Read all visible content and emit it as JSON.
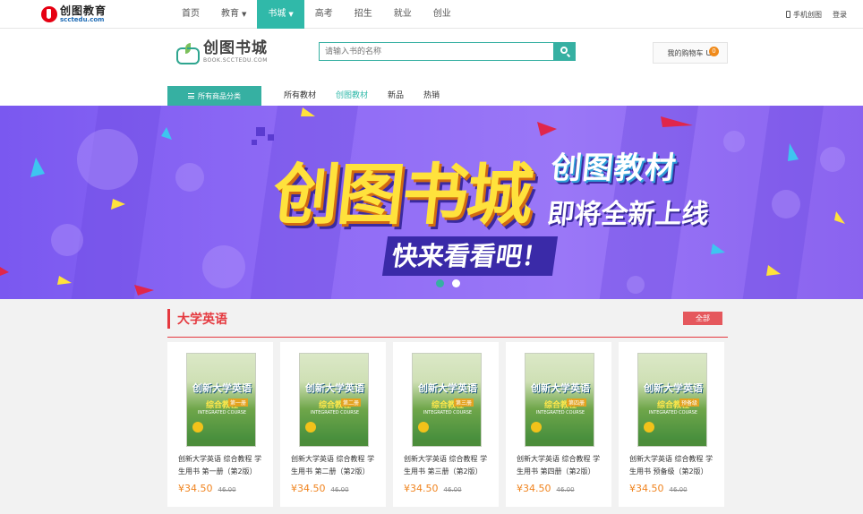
{
  "topbar": {
    "logo_cn": "创图教育",
    "logo_en": "scctedu.com",
    "nav": [
      {
        "label": "首页",
        "caret": false
      },
      {
        "label": "教育",
        "caret": true
      },
      {
        "label": "书城",
        "caret": true,
        "active": true
      },
      {
        "label": "高考",
        "caret": false
      },
      {
        "label": "招生",
        "caret": false
      },
      {
        "label": "就业",
        "caret": false
      },
      {
        "label": "创业",
        "caret": false
      }
    ],
    "mobile_label": "手机创图",
    "login_label": "登录"
  },
  "header": {
    "shop_cn": "创图书城",
    "shop_en": "BOOK.SCCTEDU.COM",
    "search_placeholder": "请输入书的名称",
    "cart_label": "我的购物车",
    "cart_count": "0",
    "category_label": "所有商品分类",
    "sub_nav": [
      {
        "label": "所有教材",
        "active": false
      },
      {
        "label": "创图教材",
        "active": true
      },
      {
        "label": "新品",
        "active": false
      },
      {
        "label": "热销",
        "active": false
      }
    ]
  },
  "banner": {
    "title": "创图书城",
    "line1": "创图教材",
    "line2": "即将全新上线",
    "line3": "快来看看吧！",
    "slides": 2,
    "active_slide": 0
  },
  "section": {
    "title": "大学英语",
    "more_label": "全部",
    "books": [
      {
        "name": "创新大学英语 综合教程 学生用书 第一册（第2版）",
        "price": "¥34.50",
        "orig": "46.00",
        "cover_title": "创新大学英语",
        "cover_sub": "综合教程",
        "cover_vol": "第一册",
        "cover_en": "INTEGRATED COURSE"
      },
      {
        "name": "创新大学英语 综合教程 学生用书 第二册（第2版）",
        "price": "¥34.50",
        "orig": "46.00",
        "cover_title": "创新大学英语",
        "cover_sub": "综合教程",
        "cover_vol": "第二册",
        "cover_en": "INTEGRATED COURSE"
      },
      {
        "name": "创新大学英语 综合教程 学生用书 第三册（第2版）",
        "price": "¥34.50",
        "orig": "46.00",
        "cover_title": "创新大学英语",
        "cover_sub": "综合教程",
        "cover_vol": "第三册",
        "cover_en": "INTEGRATED COURSE"
      },
      {
        "name": "创新大学英语 综合教程 学生用书 第四册（第2版）",
        "price": "¥34.50",
        "orig": "46.00",
        "cover_title": "创新大学英语",
        "cover_sub": "综合教程",
        "cover_vol": "第四册",
        "cover_en": "INTEGRATED COURSE"
      },
      {
        "name": "创新大学英语 综合教程 学生用书 预备级（第2版）",
        "price": "¥34.50",
        "orig": "46.00",
        "cover_title": "创新大学英语",
        "cover_sub": "综合教程",
        "cover_vol": "预备级",
        "cover_en": "INTEGRATED COURSE"
      }
    ]
  }
}
